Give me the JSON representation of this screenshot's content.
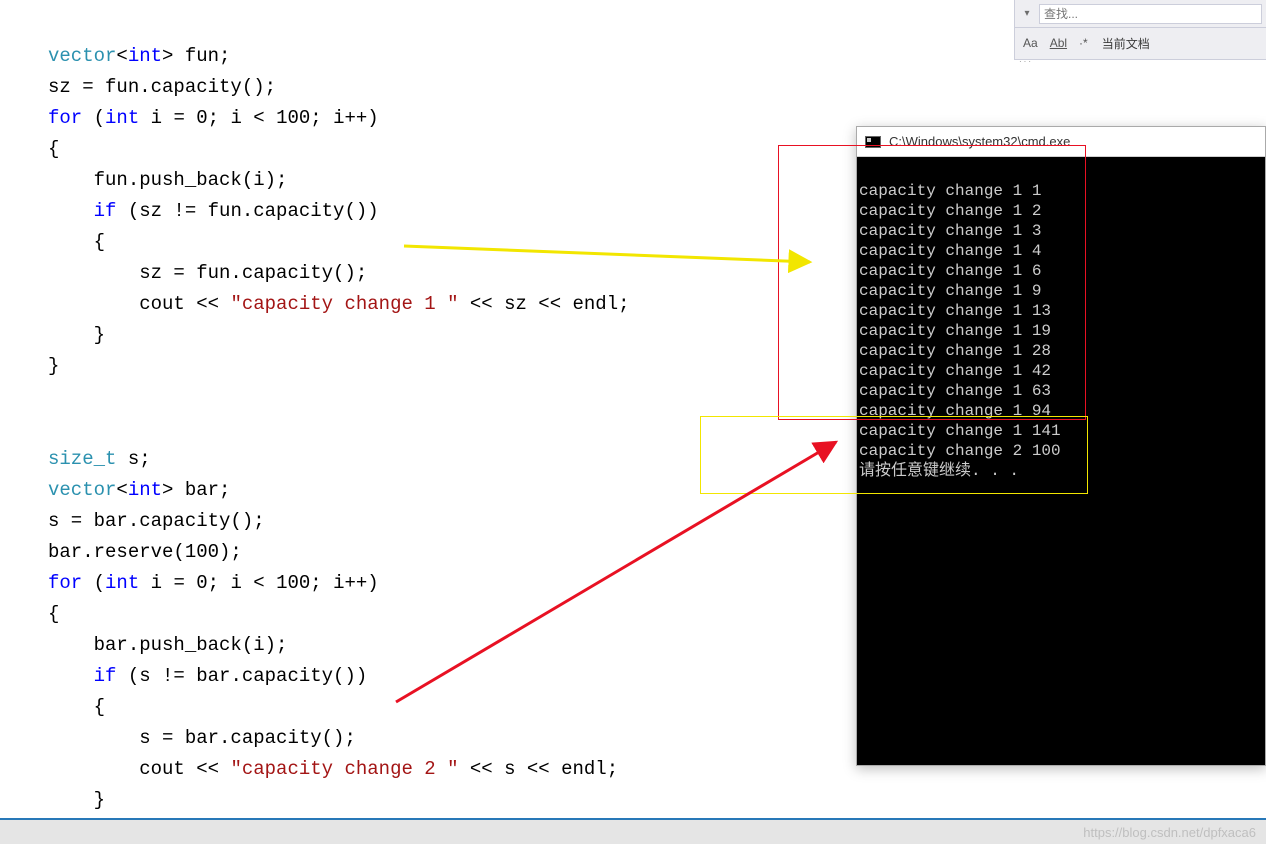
{
  "find_panel": {
    "placeholder": "查找...",
    "case_opt": "Aa",
    "whole_word_opt": "Abl",
    "regex_opt": "·*",
    "scope_label": "当前文档"
  },
  "code": {
    "l01_a": "vector",
    "l01_b": "<",
    "l01_c": "int",
    "l01_d": "> fun;",
    "l02": "sz = fun.capacity();",
    "l03_a": "for",
    "l03_b": " (",
    "l03_c": "int",
    "l03_d": " i = 0; i < 100; i++)",
    "l04": "{",
    "l05": "    fun.push_back(i);",
    "l06_a": "    ",
    "l06_b": "if",
    "l06_c": " (sz != fun.capacity())",
    "l07": "    {",
    "l08": "        sz = fun.capacity();",
    "l09_a": "        cout << ",
    "l09_str": "\"capacity change 1 \"",
    "l09_b": " << sz << endl;",
    "l10": "    }",
    "l11": "}",
    "l12": "",
    "l13": "",
    "l14_a": "size_t",
    "l14_b": " s;",
    "l15_a": "vector",
    "l15_b": "<",
    "l15_c": "int",
    "l15_d": "> bar;",
    "l16": "s = bar.capacity();",
    "l17": "bar.reserve(100);",
    "l18_a": "for",
    "l18_b": " (",
    "l18_c": "int",
    "l18_d": " i = 0; i < 100; i++)",
    "l19": "{",
    "l20": "    bar.push_back(i);",
    "l21_a": "    ",
    "l21_b": "if",
    "l21_c": " (s != bar.capacity())",
    "l22": "    {",
    "l23": "        s = bar.capacity();",
    "l24_a": "        cout << ",
    "l24_str": "\"capacity change 2 \"",
    "l24_b": " << s << endl;",
    "l25": "    }",
    "l26": "}"
  },
  "console": {
    "title": "C:\\Windows\\system32\\cmd.exe",
    "lines": [
      "capacity change 1 1",
      "capacity change 1 2",
      "capacity change 1 3",
      "capacity change 1 4",
      "capacity change 1 6",
      "capacity change 1 9",
      "capacity change 1 13",
      "capacity change 1 19",
      "capacity change 1 28",
      "capacity change 1 42",
      "capacity change 1 63",
      "capacity change 1 94",
      "capacity change 1 141",
      "capacity change 2 100",
      "请按任意键继续. . ."
    ]
  },
  "watermark": "https://blog.csdn.net/dpfxaca6"
}
